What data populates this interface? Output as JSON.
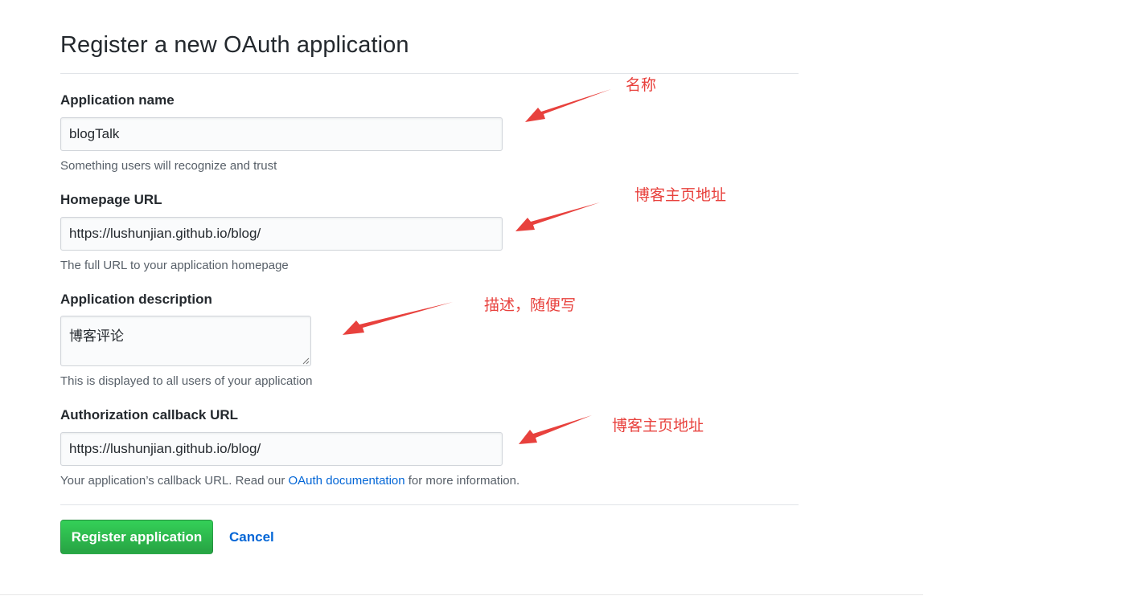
{
  "page": {
    "title": "Register a new OAuth application"
  },
  "form": {
    "app_name": {
      "label": "Application name",
      "value": "blogTalk",
      "note": "Something users will recognize and trust"
    },
    "homepage": {
      "label": "Homepage URL",
      "value": "https://lushunjian.github.io/blog/",
      "note": "The full URL to your application homepage"
    },
    "description": {
      "label": "Application description",
      "value": "博客评论",
      "note": "This is displayed to all users of your application"
    },
    "callback": {
      "label": "Authorization callback URL",
      "value": "https://lushunjian.github.io/blog/",
      "note_prefix": "Your application’s callback URL. Read our ",
      "note_link": "OAuth documentation",
      "note_suffix": " for more information."
    },
    "submit_label": "Register application",
    "cancel_label": "Cancel"
  },
  "annotations": {
    "name": "名称",
    "homepage": "博客主页地址",
    "description": "描述，随便写",
    "callback": "博客主页地址"
  },
  "colors": {
    "annotation": "#e8413d",
    "primary_button": "#28a745",
    "link": "#0366d6"
  }
}
